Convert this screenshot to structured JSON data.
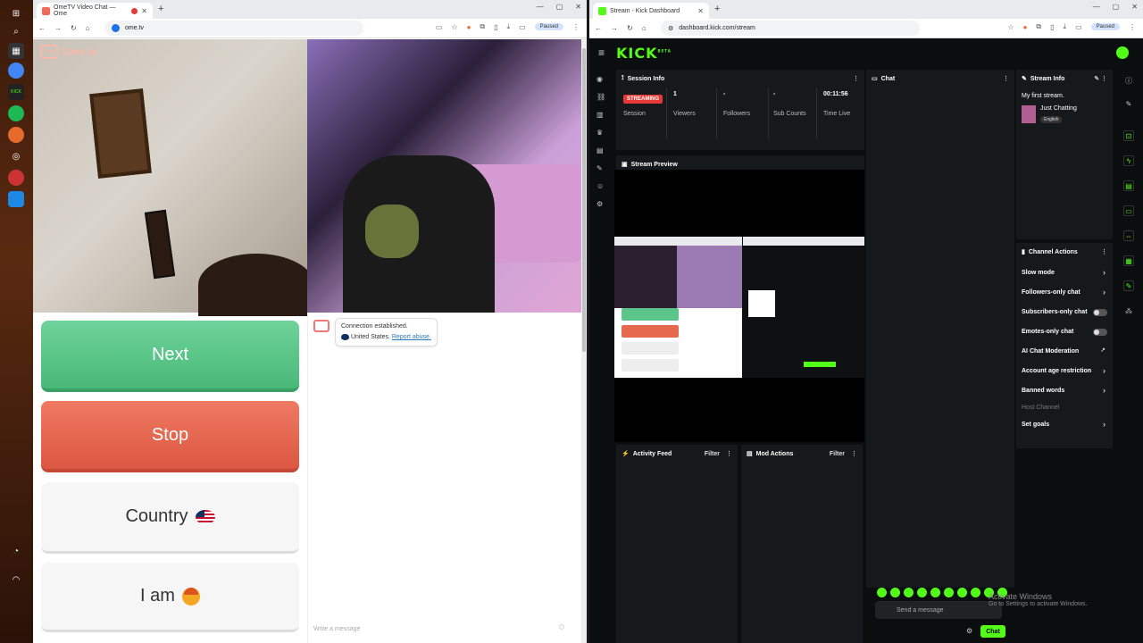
{
  "left_window": {
    "tab_title": "OmeTV Video Chat — Ome",
    "url": "ome.tv",
    "profile": "Paused",
    "logo": "Ome.tv",
    "buttons": {
      "next": "Next",
      "stop": "Stop",
      "country": "Country",
      "iam": "I am"
    },
    "chat": {
      "system_line1": "Connection established.",
      "system_country": "United States.",
      "report": "Report abuse.",
      "placeholder": "Write a message"
    }
  },
  "right_window": {
    "tab_title": "Stream - Kick Dashboard",
    "url": "dashboard.kick.com/stream",
    "profile": "Paused",
    "logo": "KICK",
    "logo_badge": "BETA",
    "session_info": {
      "title": "Session Info",
      "status": "STREAMING",
      "session_label": "Session",
      "viewers_value": "1",
      "viewers_label": "Viewers",
      "followers_value": "-",
      "followers_label": "Followers",
      "subs_value": "-",
      "subs_label": "Sub Counts",
      "time_value": "00:11:56",
      "time_label": "Time Live"
    },
    "chat_title": "Chat",
    "stream_info": {
      "title": "Stream Info",
      "stream_title": "My first stream.",
      "category": "Just Chatting",
      "language": "English"
    },
    "stream_preview_title": "Stream Preview",
    "channel_actions": {
      "title": "Channel Actions",
      "items": [
        "Slow mode",
        "Followers-only chat",
        "Subscribers-only chat",
        "Emotes-only chat",
        "AI Chat Moderation",
        "Account age restriction",
        "Banned words",
        "Host Channel",
        "Set goals"
      ]
    },
    "activity_feed": {
      "title": "Activity Feed",
      "filter": "Filter"
    },
    "mod_actions": {
      "title": "Mod Actions",
      "filter": "Filter"
    },
    "chat_input_placeholder": "Send a message",
    "chat_button": "Chat",
    "watermark_title": "Activate Windows",
    "watermark_sub": "Go to Settings to activate Windows."
  },
  "colors": {
    "kick_green": "#53fc18",
    "next_green": "#49b978",
    "stop_red": "#dc5741",
    "streaming_red": "#e53935"
  }
}
